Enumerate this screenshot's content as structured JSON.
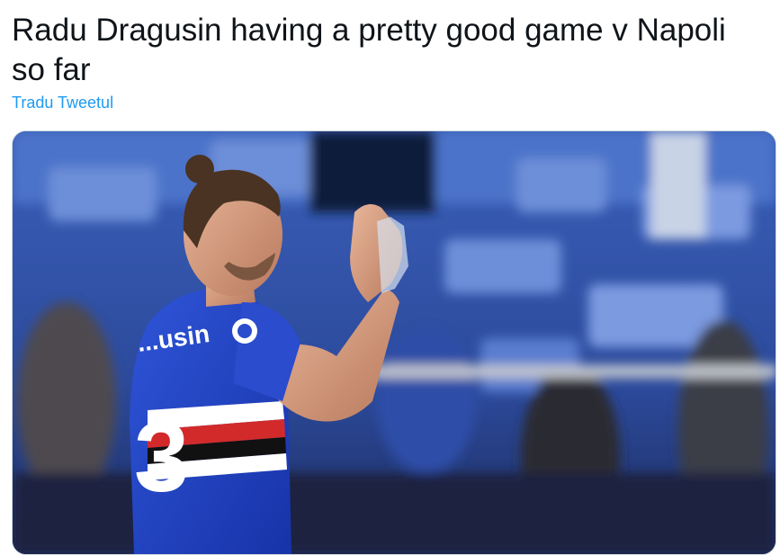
{
  "tweet": {
    "text": "Radu Dragusin having a pretty good game v Napoli so far",
    "translate_label": "Tradu Tweetul"
  },
  "photo": {
    "jersey_name": "...usin",
    "jersey_number": "3"
  }
}
